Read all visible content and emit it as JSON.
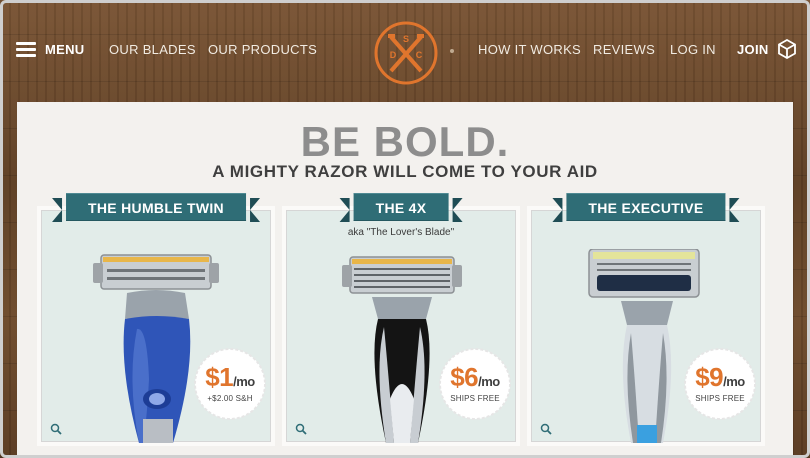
{
  "nav": {
    "menu_label": "MENU",
    "our_blades": "OUR BLADES",
    "our_products": "OUR PRODUCTS",
    "how_it_works": "HOW IT WORKS",
    "reviews": "REVIEWS",
    "log_in": "LOG IN",
    "join": "JOIN",
    "logo_letters": [
      "S",
      "D",
      "C"
    ]
  },
  "hero": {
    "headline": "BE BOLD.",
    "subline": "A MIGHTY RAZOR WILL COME TO YOUR AID"
  },
  "products": [
    {
      "name": "THE HUMBLE TWIN",
      "aka": "",
      "price": "$1",
      "per": "/mo",
      "note": "+$2.00 S&H",
      "handle_color": "#2f55b8"
    },
    {
      "name": "THE 4X",
      "aka": "aka \"The Lover's Blade\"",
      "price": "$6",
      "per": "/mo",
      "note": "SHIPS FREE",
      "handle_color": "#141414"
    },
    {
      "name": "THE EXECUTIVE",
      "aka": "",
      "price": "$9",
      "per": "/mo",
      "note": "SHIPS FREE",
      "handle_color": "#cfd6dc"
    }
  ],
  "colors": {
    "accent_orange": "#e0752d",
    "banner_teal": "#2f6d76",
    "card_bg": "#e2ece9",
    "headline_gray": "#8d8d8d"
  }
}
